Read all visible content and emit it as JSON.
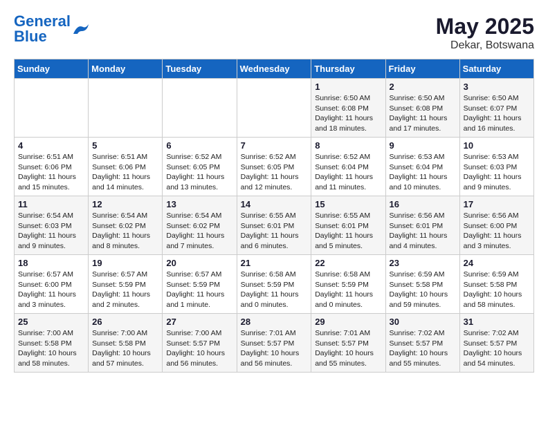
{
  "header": {
    "logo_general": "General",
    "logo_blue": "Blue",
    "month": "May 2025",
    "location": "Dekar, Botswana"
  },
  "weekdays": [
    "Sunday",
    "Monday",
    "Tuesday",
    "Wednesday",
    "Thursday",
    "Friday",
    "Saturday"
  ],
  "weeks": [
    [
      {
        "day": "",
        "info": ""
      },
      {
        "day": "",
        "info": ""
      },
      {
        "day": "",
        "info": ""
      },
      {
        "day": "",
        "info": ""
      },
      {
        "day": "1",
        "info": "Sunrise: 6:50 AM\nSunset: 6:08 PM\nDaylight: 11 hours\nand 18 minutes."
      },
      {
        "day": "2",
        "info": "Sunrise: 6:50 AM\nSunset: 6:08 PM\nDaylight: 11 hours\nand 17 minutes."
      },
      {
        "day": "3",
        "info": "Sunrise: 6:50 AM\nSunset: 6:07 PM\nDaylight: 11 hours\nand 16 minutes."
      }
    ],
    [
      {
        "day": "4",
        "info": "Sunrise: 6:51 AM\nSunset: 6:06 PM\nDaylight: 11 hours\nand 15 minutes."
      },
      {
        "day": "5",
        "info": "Sunrise: 6:51 AM\nSunset: 6:06 PM\nDaylight: 11 hours\nand 14 minutes."
      },
      {
        "day": "6",
        "info": "Sunrise: 6:52 AM\nSunset: 6:05 PM\nDaylight: 11 hours\nand 13 minutes."
      },
      {
        "day": "7",
        "info": "Sunrise: 6:52 AM\nSunset: 6:05 PM\nDaylight: 11 hours\nand 12 minutes."
      },
      {
        "day": "8",
        "info": "Sunrise: 6:52 AM\nSunset: 6:04 PM\nDaylight: 11 hours\nand 11 minutes."
      },
      {
        "day": "9",
        "info": "Sunrise: 6:53 AM\nSunset: 6:04 PM\nDaylight: 11 hours\nand 10 minutes."
      },
      {
        "day": "10",
        "info": "Sunrise: 6:53 AM\nSunset: 6:03 PM\nDaylight: 11 hours\nand 9 minutes."
      }
    ],
    [
      {
        "day": "11",
        "info": "Sunrise: 6:54 AM\nSunset: 6:03 PM\nDaylight: 11 hours\nand 9 minutes."
      },
      {
        "day": "12",
        "info": "Sunrise: 6:54 AM\nSunset: 6:02 PM\nDaylight: 11 hours\nand 8 minutes."
      },
      {
        "day": "13",
        "info": "Sunrise: 6:54 AM\nSunset: 6:02 PM\nDaylight: 11 hours\nand 7 minutes."
      },
      {
        "day": "14",
        "info": "Sunrise: 6:55 AM\nSunset: 6:01 PM\nDaylight: 11 hours\nand 6 minutes."
      },
      {
        "day": "15",
        "info": "Sunrise: 6:55 AM\nSunset: 6:01 PM\nDaylight: 11 hours\nand 5 minutes."
      },
      {
        "day": "16",
        "info": "Sunrise: 6:56 AM\nSunset: 6:01 PM\nDaylight: 11 hours\nand 4 minutes."
      },
      {
        "day": "17",
        "info": "Sunrise: 6:56 AM\nSunset: 6:00 PM\nDaylight: 11 hours\nand 3 minutes."
      }
    ],
    [
      {
        "day": "18",
        "info": "Sunrise: 6:57 AM\nSunset: 6:00 PM\nDaylight: 11 hours\nand 3 minutes."
      },
      {
        "day": "19",
        "info": "Sunrise: 6:57 AM\nSunset: 5:59 PM\nDaylight: 11 hours\nand 2 minutes."
      },
      {
        "day": "20",
        "info": "Sunrise: 6:57 AM\nSunset: 5:59 PM\nDaylight: 11 hours\nand 1 minute."
      },
      {
        "day": "21",
        "info": "Sunrise: 6:58 AM\nSunset: 5:59 PM\nDaylight: 11 hours\nand 0 minutes."
      },
      {
        "day": "22",
        "info": "Sunrise: 6:58 AM\nSunset: 5:59 PM\nDaylight: 11 hours\nand 0 minutes."
      },
      {
        "day": "23",
        "info": "Sunrise: 6:59 AM\nSunset: 5:58 PM\nDaylight: 10 hours\nand 59 minutes."
      },
      {
        "day": "24",
        "info": "Sunrise: 6:59 AM\nSunset: 5:58 PM\nDaylight: 10 hours\nand 58 minutes."
      }
    ],
    [
      {
        "day": "25",
        "info": "Sunrise: 7:00 AM\nSunset: 5:58 PM\nDaylight: 10 hours\nand 58 minutes."
      },
      {
        "day": "26",
        "info": "Sunrise: 7:00 AM\nSunset: 5:58 PM\nDaylight: 10 hours\nand 57 minutes."
      },
      {
        "day": "27",
        "info": "Sunrise: 7:00 AM\nSunset: 5:57 PM\nDaylight: 10 hours\nand 56 minutes."
      },
      {
        "day": "28",
        "info": "Sunrise: 7:01 AM\nSunset: 5:57 PM\nDaylight: 10 hours\nand 56 minutes."
      },
      {
        "day": "29",
        "info": "Sunrise: 7:01 AM\nSunset: 5:57 PM\nDaylight: 10 hours\nand 55 minutes."
      },
      {
        "day": "30",
        "info": "Sunrise: 7:02 AM\nSunset: 5:57 PM\nDaylight: 10 hours\nand 55 minutes."
      },
      {
        "day": "31",
        "info": "Sunrise: 7:02 AM\nSunset: 5:57 PM\nDaylight: 10 hours\nand 54 minutes."
      }
    ]
  ]
}
